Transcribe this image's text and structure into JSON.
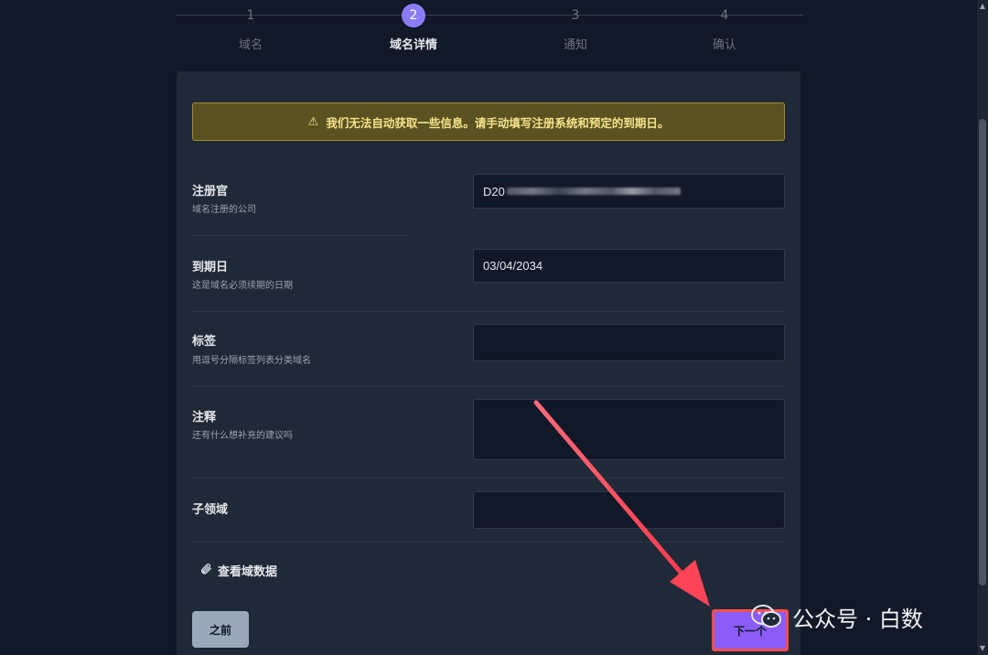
{
  "stepper": {
    "steps": [
      {
        "num": "1",
        "label": "域名"
      },
      {
        "num": "2",
        "label": "域名详情"
      },
      {
        "num": "3",
        "label": "通知"
      },
      {
        "num": "4",
        "label": "确认"
      }
    ],
    "active_step": "2"
  },
  "alert": {
    "icon": "warning-icon",
    "text": "我们无法自动获取一些信息。请手动填写注册系统和预定的到期日。"
  },
  "form": {
    "registrar": {
      "label": "注册官",
      "desc": "域名注册的公司",
      "value": "D20"
    },
    "expiry": {
      "label": "到期日",
      "desc": "这是域名必须续期的日期",
      "value": "03/04/2034"
    },
    "tags": {
      "label": "标签",
      "desc": "用逗号分隔标签列表分类域名",
      "value": ""
    },
    "notes": {
      "label": "注释",
      "desc": "还有什么想补充的建议吗",
      "value": ""
    },
    "subdomains": {
      "label": "子领域",
      "value": ""
    }
  },
  "view_data": {
    "icon": "paperclip-icon",
    "label": "查看域数据"
  },
  "buttons": {
    "prev": "之前",
    "next": "下一个"
  },
  "annotation": {
    "arrow_color": "#ff4d5e",
    "highlight_color": "#ff4d4d"
  },
  "watermark": {
    "text": "公众号 · 白数",
    "icon": "wechat-icon"
  },
  "colors": {
    "accent": "#8b7cf6",
    "warning_bg": "#5b5222",
    "warning_text": "#f4e38a"
  }
}
